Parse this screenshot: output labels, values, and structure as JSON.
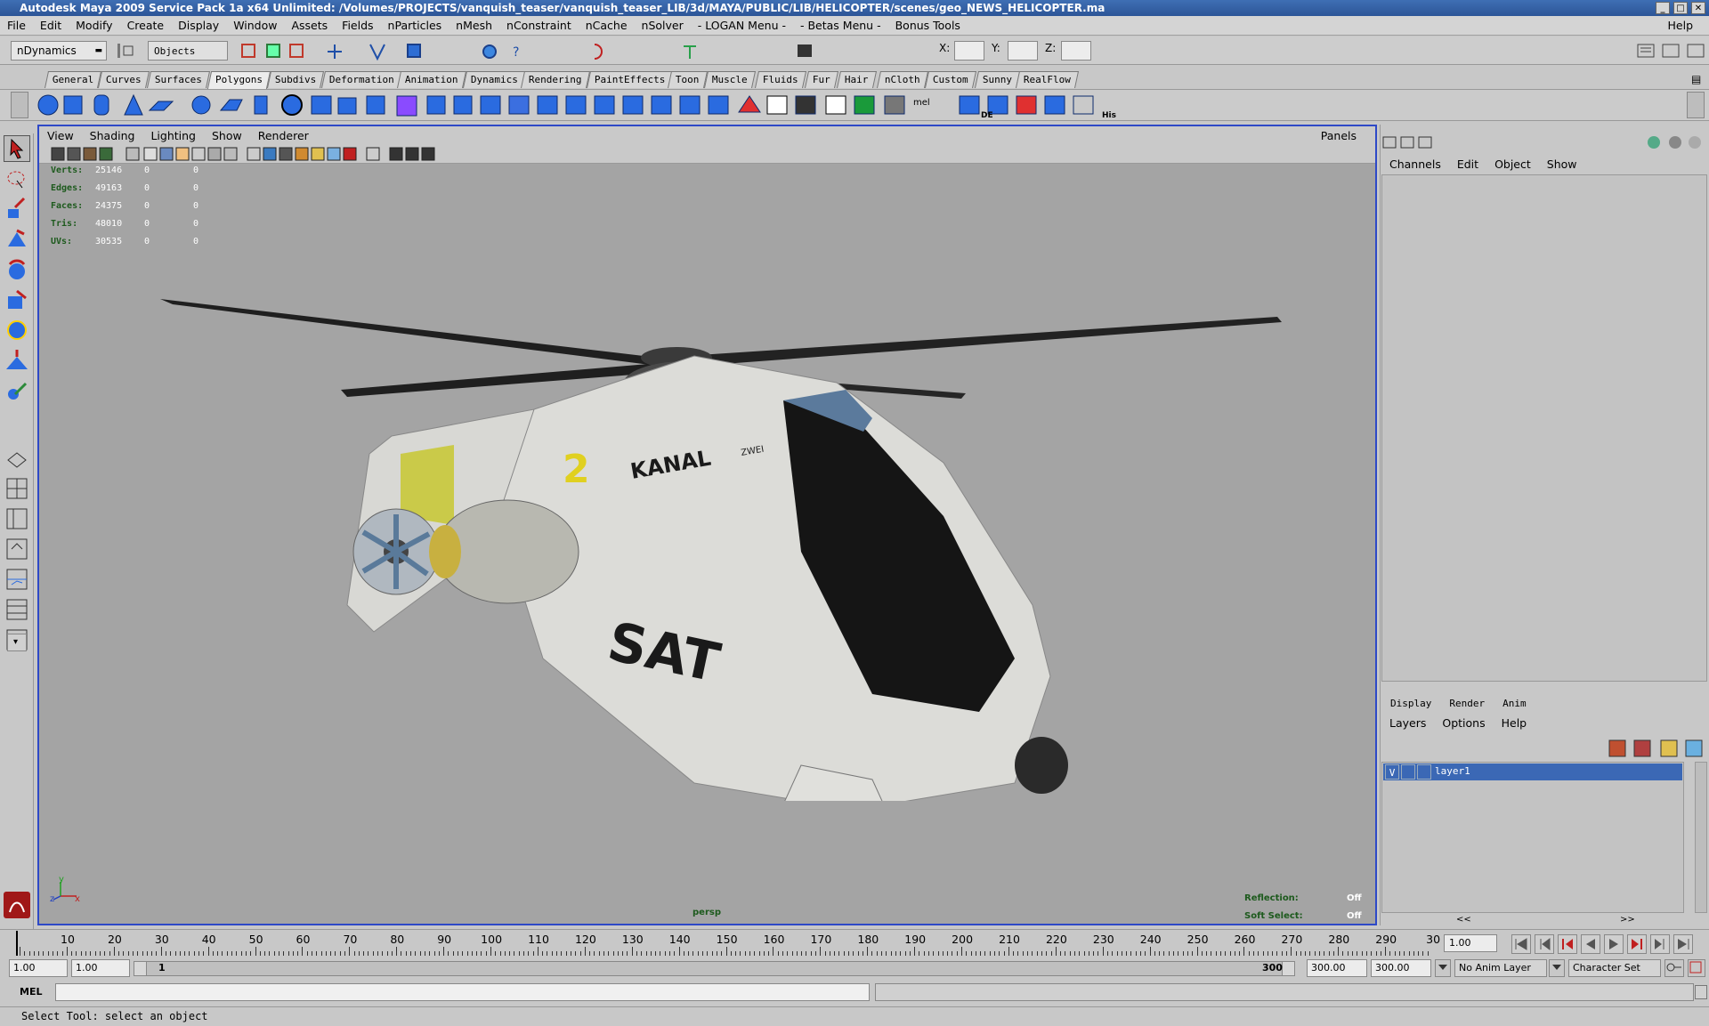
{
  "title": "Autodesk Maya 2009 Service Pack 1a x64 Unlimited: /Volumes/PROJECTS/vanquish_teaser/vanquish_teaser_LIB/3d/MAYA/PUBLIC/LIB/HELICOPTER/scenes/geo_NEWS_HELICOPTER.ma",
  "window_buttons": [
    "_",
    "□",
    "✕"
  ],
  "menus": [
    "File",
    "Edit",
    "Modify",
    "Create",
    "Display",
    "Window",
    "Assets",
    "Fields",
    "nParticles",
    "nMesh",
    "nConstraint",
    "nCache",
    "nSolver",
    "- LOGAN Menu -",
    "- Betas Menu -",
    "Bonus Tools"
  ],
  "help_menu": "Help",
  "status": {
    "menuset": "nDynamics",
    "selection_mode": "Objects",
    "x_label": "X:",
    "y_label": "Y:",
    "z_label": "Z:"
  },
  "shelf_tabs": [
    "General",
    "Curves",
    "Surfaces",
    "Polygons",
    "Subdivs",
    "Deformation",
    "Animation",
    "Dynamics",
    "Rendering",
    "PaintEffects",
    "Toon",
    "Muscle",
    "Fluids",
    "Fur",
    "Hair",
    "nCloth",
    "Custom",
    "Sunny",
    "RealFlow"
  ],
  "active_shelf": "Polygons",
  "shelf_text": {
    "mel": "mel",
    "de": "DE",
    "his": "His"
  },
  "viewport": {
    "menus": [
      "View",
      "Shading",
      "Lighting",
      "Show",
      "Renderer"
    ],
    "panels": "Panels",
    "camera": "persp",
    "hud": [
      {
        "label": "Verts:",
        "v1": "25146",
        "v2": "0",
        "v3": "0"
      },
      {
        "label": "Edges:",
        "v1": "49163",
        "v2": "0",
        "v3": "0"
      },
      {
        "label": "Faces:",
        "v1": "24375",
        "v2": "0",
        "v3": "0"
      },
      {
        "label": "Tris:",
        "v1": "48010",
        "v2": "0",
        "v3": "0"
      },
      {
        "label": "UVs:",
        "v1": "30535",
        "v2": "0",
        "v3": "0"
      }
    ],
    "reflection_label": "Reflection:",
    "reflection_value": "Off",
    "soft_select_label": "Soft Select:",
    "soft_select_value": "Off",
    "model_text": {
      "kanal": "KANAL",
      "zwei": "ZWEI",
      "sat": "SAT",
      "digit": "2"
    }
  },
  "channel_box": {
    "menus": [
      "Channels",
      "Edit",
      "Object",
      "Show"
    ]
  },
  "layer_editor": {
    "tabs": [
      "Display",
      "Render",
      "Anim"
    ],
    "menus": [
      "Layers",
      "Options",
      "Help"
    ],
    "layer": {
      "visible": "V",
      "name": "layer1"
    },
    "scroll_left": "<<",
    "scroll_right": ">>"
  },
  "timeline": {
    "ticks": [
      "10",
      "20",
      "30",
      "40",
      "50",
      "60",
      "70",
      "80",
      "90",
      "100",
      "110",
      "120",
      "130",
      "140",
      "150",
      "160",
      "170",
      "180",
      "190",
      "200",
      "210",
      "220",
      "230",
      "240",
      "250",
      "260",
      "270",
      "280",
      "290",
      "30"
    ],
    "current_frame": "1.00"
  },
  "range": {
    "start_time": "1.00",
    "start_playback": "1.00",
    "range_start_label": "1",
    "range_end_label": "300",
    "end_playback": "300.00",
    "end_time": "300.00",
    "anim_layer": "No Anim Layer",
    "character_set": "Character Set"
  },
  "command": {
    "label": "MEL"
  },
  "help_line": "Select Tool: select an object",
  "colors": {
    "viewport_border": "#2e49c7",
    "layer_selected": "#3b68b5",
    "hud_label": "#1d5a1d"
  }
}
